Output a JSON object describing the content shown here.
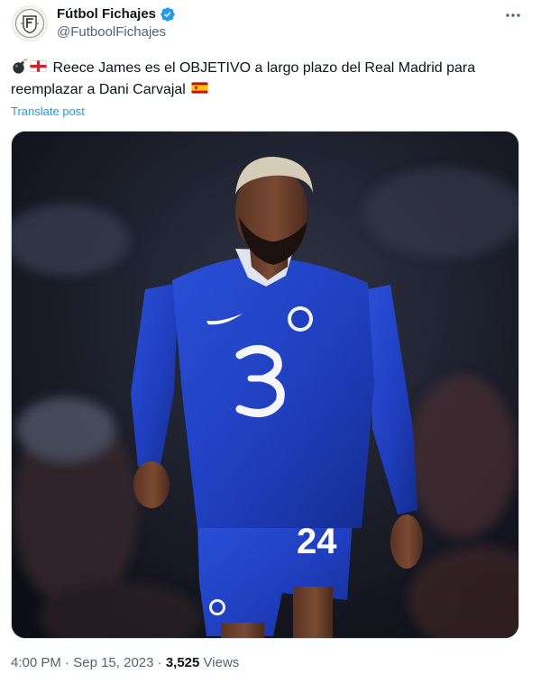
{
  "account": {
    "display_name": "Fútbol Fichajes",
    "handle": "@FutboolFichajes",
    "verified": true,
    "verified_color": "#1d9bf0",
    "avatar_icon": "shield-crest-icon"
  },
  "menu": {
    "more_icon": "more-horizontal-icon"
  },
  "post": {
    "leading_emojis": [
      "bomb",
      "england-flag"
    ],
    "text_line_1": "Reece James es el OBJETIVO a largo plazo del Real Madrid para",
    "text_line_2": "reemplazar a Dani Carvajal",
    "trailing_emoji": "spain-flag",
    "translate_label": "Translate post",
    "link_color": "#1d9bf0"
  },
  "media": {
    "kind": "photo",
    "shirt_number": "24",
    "sponsor_mark": "3",
    "kit_color": "#1f3fbf"
  },
  "footer": {
    "time": "4:00 PM",
    "separator": "·",
    "date": "Sep 15, 2023",
    "views_count": "3,525",
    "views_label": "Views"
  }
}
